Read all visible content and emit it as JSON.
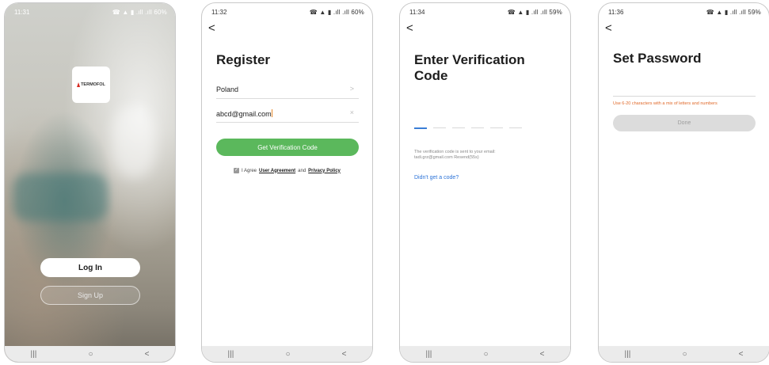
{
  "nav": {
    "recent": "|||",
    "home": "○",
    "back": "<"
  },
  "back_arrow": "<",
  "phone1": {
    "status": {
      "time": "11:31",
      "icons": "☎ ▲ ▮ .ıll .ıll 60%"
    },
    "logo_text": "TERMOFOL",
    "login_label": "Log In",
    "signup_label": "Sign Up"
  },
  "phone2": {
    "status": {
      "time": "11:32",
      "icons": "☎ ▲ ▮ .ıll .ıll 60%"
    },
    "title": "Register",
    "country": "Poland",
    "country_suffix": ">",
    "email": "abcd@gmail.com",
    "clear": "×",
    "button_label": "Get Verification Code",
    "agree_prefix": "I Agree",
    "agreement": "User Agreement",
    "and": "and",
    "privacy": "Privacy Policy"
  },
  "phone3": {
    "status": {
      "time": "11:34",
      "icons": "☎ ▲ ▮ .ıll .ıll 59%"
    },
    "title_line1": "Enter Verification",
    "title_line2": "Code",
    "info_line1": "The verification code is sent to your email:",
    "info_line2": "tadi.grz@gmail.com  Resend(55s)",
    "link": "Didn't get a code?"
  },
  "phone4": {
    "status": {
      "time": "11:36",
      "icons": "☎ ▲ ▮ .ıll .ıll 59%"
    },
    "title": "Set Password",
    "hint": "Use 6-20 characters with a mix of letters and numbers",
    "done_label": "Done"
  },
  "colors": {
    "green": "#5bb85c",
    "link_blue": "#2d74d8",
    "hint_orange": "#e0692a"
  }
}
